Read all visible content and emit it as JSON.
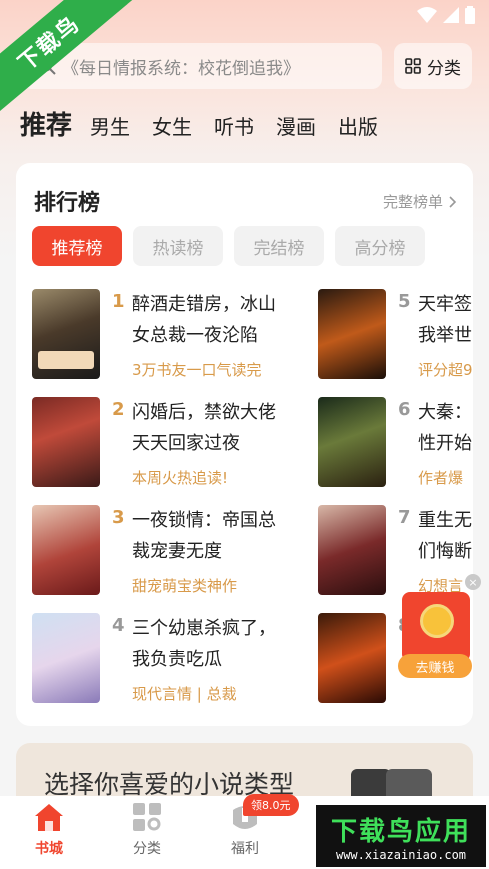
{
  "watermark": {
    "corner_text": "下载鸟",
    "logo_text": "下载鸟应用",
    "logo_url": "www.xiazainiao.com"
  },
  "search": {
    "placeholder": "《每日情报系统：校花倒追我》"
  },
  "category_button": {
    "label": "分类",
    "icon": "grid-icon"
  },
  "top_tabs": [
    "推荐",
    "男生",
    "女生",
    "听书",
    "漫画",
    "出版"
  ],
  "ranking": {
    "title": "排行榜",
    "more_label": "完整榜单",
    "tabs": [
      "推荐榜",
      "热读榜",
      "完结榜",
      "高分榜"
    ],
    "books": [
      {
        "rank": "1",
        "title_line1": "醉酒走错房，冰山",
        "title_line2": "女总裁一夜沦陷",
        "tag": "3万书友一口气读完"
      },
      {
        "rank": "2",
        "title_line1": "闪婚后，禁欲大佬",
        "title_line2": "天天回家过夜",
        "tag": "本周火热追读!"
      },
      {
        "rank": "3",
        "title_line1": "一夜锁情：帝国总",
        "title_line2": "裁宠妻无度",
        "tag": "甜宠萌宝类神作"
      },
      {
        "rank": "4",
        "title_line1": "三个幼崽杀疯了，",
        "title_line2": "我负责吃瓜",
        "tag": "现代言情 | 总裁"
      },
      {
        "rank": "5",
        "title_line1": "天牢签",
        "title_line2": "我举世",
        "tag": "评分超9"
      },
      {
        "rank": "6",
        "title_line1": "大秦：",
        "title_line2": "性开始",
        "tag": "作者爆"
      },
      {
        "rank": "7",
        "title_line1": "重生无",
        "title_line2": "们悔断",
        "tag": "幻想言"
      },
      {
        "rank": "8",
        "title_line1": "",
        "title_line2": "",
        "tag": ""
      }
    ]
  },
  "reward": {
    "earn_label": "去赚钱",
    "close": "×"
  },
  "genre": {
    "title": "选择你喜爱的小说类型"
  },
  "bottom_nav": [
    {
      "label": "书城",
      "icon": "home-icon"
    },
    {
      "label": "分类",
      "icon": "category-grid-icon"
    },
    {
      "label": "福利",
      "icon": "gift-icon"
    }
  ],
  "welfare_badge": "领8.0元",
  "colors": {
    "accent": "#f0452e",
    "tag": "#d89a4a",
    "watermark_green": "#2fae4a"
  }
}
